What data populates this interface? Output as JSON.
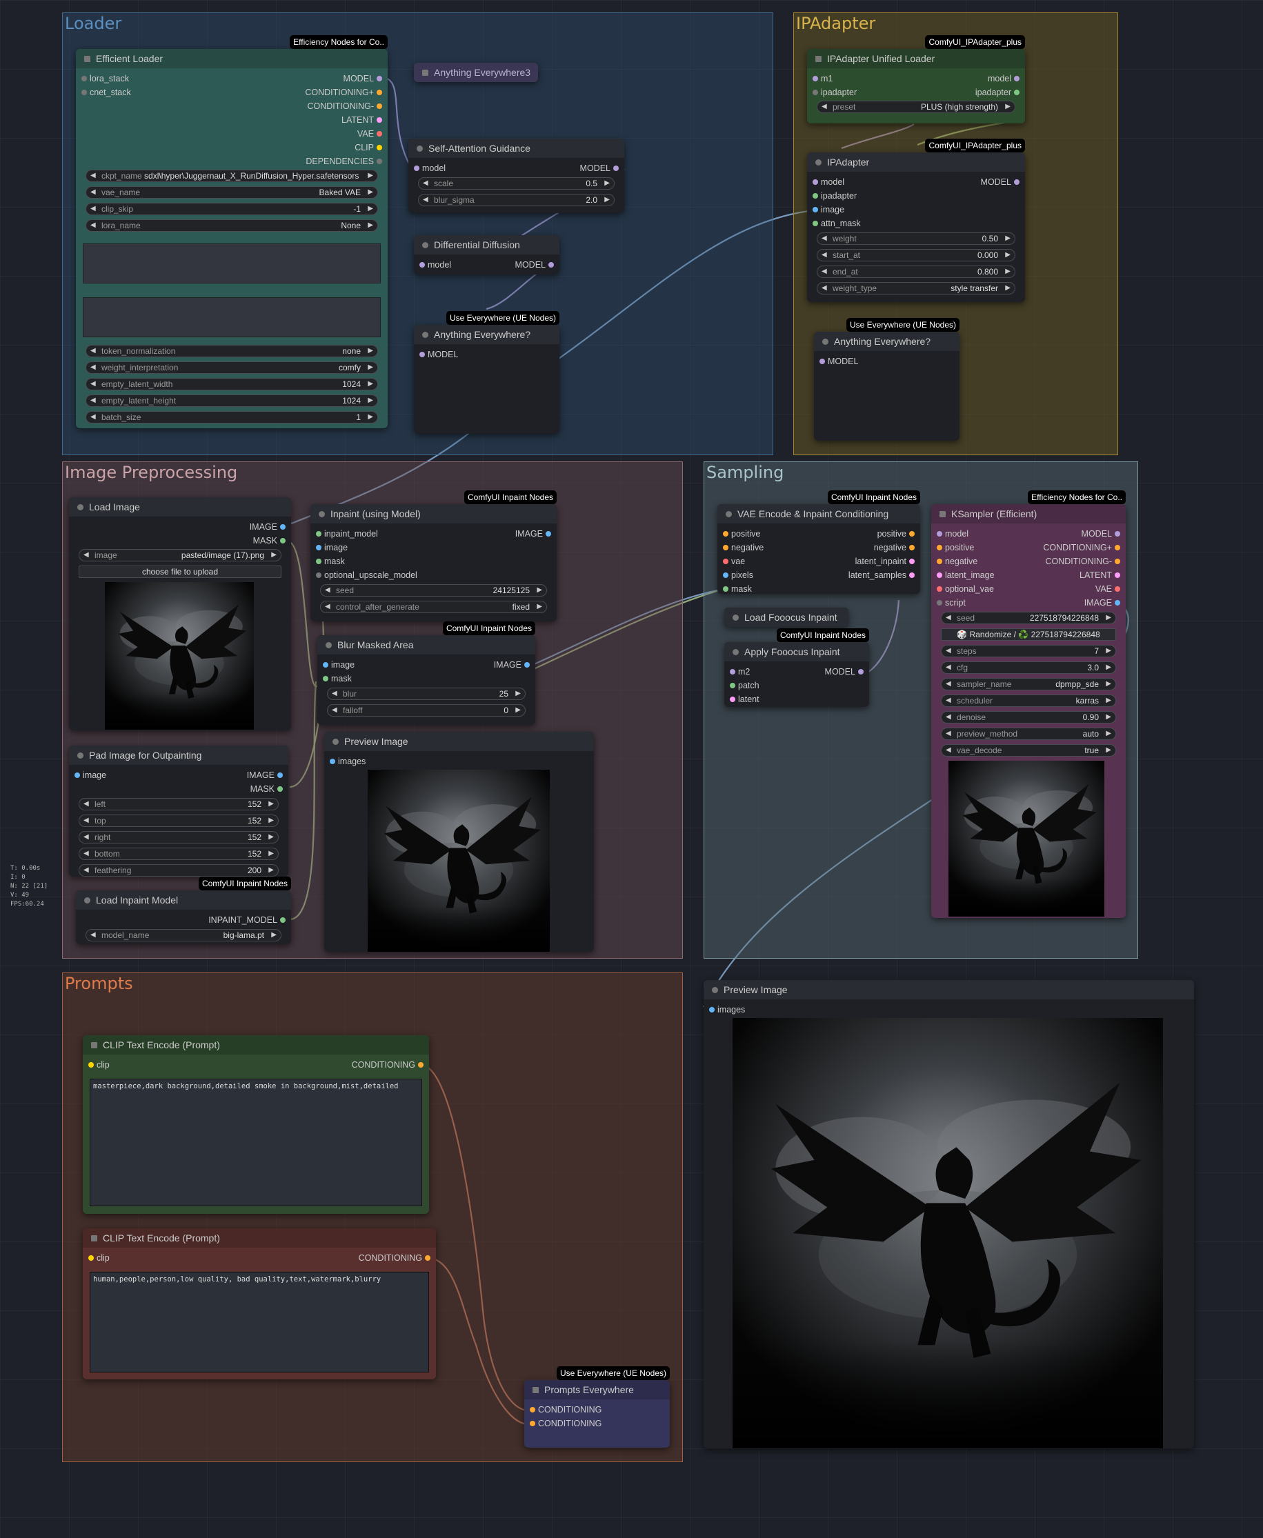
{
  "groups": {
    "loader": "Loader",
    "ipadapter": "IPAdapter",
    "preprocess": "Image Preprocessing",
    "sampling": "Sampling",
    "prompts": "Prompts"
  },
  "colors": {
    "model": "#b39ddb",
    "conditioning": "#ffa931",
    "latent": "#ff9cf9",
    "vae": "#ff6e6e",
    "clip": "#ffd500",
    "image": "#64b5f6",
    "mask": "#81c784",
    "link_model": "#b49ddb",
    "link_image": "#8aaed6",
    "link_mask": "#a8c58a",
    "link_conditioning": "#e9967a"
  },
  "stats": [
    "T: 0.00s",
    "I: 0",
    "N: 22 [21]",
    "V: 49",
    "FPS:60.24"
  ],
  "efficient_loader": {
    "badge": "Efficiency Nodes for Co..",
    "title": "Efficient Loader",
    "in": [
      "lora_stack",
      "cnet_stack"
    ],
    "out": [
      "MODEL",
      "CONDITIONING+",
      "CONDITIONING-",
      "LATENT",
      "VAE",
      "CLIP",
      "DEPENDENCIES"
    ],
    "ckpt_label": "ckpt_name",
    "ckpt_value": "sdxl\\hyper\\Juggernaut_X_RunDiffusion_Hyper.safetensors",
    "widgets": [
      {
        "k": "vae_name",
        "v": "Baked VAE"
      },
      {
        "k": "clip_skip",
        "v": "-1"
      },
      {
        "k": "lora_name",
        "v": "None"
      }
    ],
    "widgets2": [
      {
        "k": "token_normalization",
        "v": "none"
      },
      {
        "k": "weight_interpretation",
        "v": "comfy"
      },
      {
        "k": "empty_latent_width",
        "v": "1024"
      },
      {
        "k": "empty_latent_height",
        "v": "1024"
      },
      {
        "k": "batch_size",
        "v": "1"
      }
    ]
  },
  "anything3": {
    "title": "Anything Everywhere3"
  },
  "sag": {
    "title": "Self-Attention Guidance",
    "in": "model",
    "out": "MODEL",
    "widgets": [
      {
        "k": "scale",
        "v": "0.5"
      },
      {
        "k": "blur_sigma",
        "v": "2.0"
      }
    ]
  },
  "diffdiff": {
    "title": "Differential Diffusion",
    "in": "model",
    "out": "MODEL"
  },
  "anything_l": {
    "badge": "Use Everywhere (UE Nodes)",
    "title": "Anything Everywhere?",
    "in": "MODEL"
  },
  "ip_loader": {
    "badge": "ComfyUI_IPAdapter_plus",
    "title": "IPAdapter Unified Loader",
    "in": [
      "m1",
      "ipadapter"
    ],
    "out": [
      "model",
      "ipadapter"
    ],
    "preset_k": "preset",
    "preset_v": "PLUS (high strength)"
  },
  "ipadapter": {
    "badge": "ComfyUI_IPAdapter_plus",
    "title": "IPAdapter",
    "in": [
      "model",
      "ipadapter",
      "image",
      "attn_mask"
    ],
    "out": "MODEL",
    "widgets": [
      {
        "k": "weight",
        "v": "0.50"
      },
      {
        "k": "start_at",
        "v": "0.000"
      },
      {
        "k": "end_at",
        "v": "0.800"
      },
      {
        "k": "weight_type",
        "v": "style transfer"
      }
    ]
  },
  "anything_r": {
    "badge": "Use Everywhere (UE Nodes)",
    "title": "Anything Everywhere?",
    "in": "MODEL"
  },
  "load_image": {
    "title": "Load Image",
    "out": [
      "IMAGE",
      "MASK"
    ],
    "image_k": "image",
    "image_v": "pasted/image (17).png",
    "upload": "choose file to upload"
  },
  "inpaint_model": {
    "badge": "ComfyUI Inpaint Nodes",
    "title": "Inpaint (using Model)",
    "in": [
      "inpaint_model",
      "image",
      "mask",
      "optional_upscale_model"
    ],
    "out": "IMAGE",
    "widgets": [
      {
        "k": "seed",
        "v": "24125125"
      },
      {
        "k": "control_after_generate",
        "v": "fixed"
      }
    ]
  },
  "blur": {
    "badge": "ComfyUI Inpaint Nodes",
    "title": "Blur Masked Area",
    "in": [
      "image",
      "mask"
    ],
    "out": "IMAGE",
    "widgets": [
      {
        "k": "blur",
        "v": "25"
      },
      {
        "k": "falloff",
        "v": "0"
      }
    ]
  },
  "pad": {
    "title": "Pad Image for Outpainting",
    "in": "image",
    "out": [
      "IMAGE",
      "MASK"
    ],
    "widgets": [
      {
        "k": "left",
        "v": "152"
      },
      {
        "k": "top",
        "v": "152"
      },
      {
        "k": "right",
        "v": "152"
      },
      {
        "k": "bottom",
        "v": "152"
      },
      {
        "k": "feathering",
        "v": "200"
      }
    ]
  },
  "preview_small": {
    "title": "Preview Image",
    "in": "images"
  },
  "load_inpaint": {
    "badge": "ComfyUI Inpaint Nodes",
    "title": "Load Inpaint Model",
    "out": "INPAINT_MODEL",
    "widget_k": "model_name",
    "widget_v": "big-lama.pt"
  },
  "vae_encode": {
    "badge": "ComfyUI Inpaint Nodes",
    "title": "VAE Encode & Inpaint Conditioning",
    "in": [
      "positive",
      "negative",
      "vae",
      "pixels",
      "mask"
    ],
    "out": [
      "positive",
      "negative",
      "latent_inpaint",
      "latent_samples"
    ]
  },
  "fooocus_load": {
    "title": "Load Fooocus Inpaint"
  },
  "fooocus_apply": {
    "badge": "ComfyUI Inpaint Nodes",
    "title": "Apply Fooocus Inpaint",
    "in": [
      "m2",
      "patch",
      "latent"
    ],
    "out": "MODEL"
  },
  "ksampler": {
    "badge": "Efficiency Nodes for Co..",
    "title": "KSampler (Efficient)",
    "in": [
      "model",
      "positive",
      "negative",
      "latent_image",
      "optional_vae",
      "script"
    ],
    "out": [
      "MODEL",
      "CONDITIONING+",
      "CONDITIONING-",
      "LATENT",
      "VAE",
      "IMAGE"
    ],
    "seed_k": "seed",
    "seed_v": "227518794226848",
    "randomize": "🎲 Randomize / ♻️ 227518794226848",
    "widgets": [
      {
        "k": "steps",
        "v": "7"
      },
      {
        "k": "cfg",
        "v": "3.0"
      },
      {
        "k": "sampler_name",
        "v": "dpmpp_sde"
      },
      {
        "k": "scheduler",
        "v": "karras"
      },
      {
        "k": "denoise",
        "v": "0.90"
      },
      {
        "k": "preview_method",
        "v": "auto"
      },
      {
        "k": "vae_decode",
        "v": "true"
      }
    ]
  },
  "preview_large": {
    "title": "Preview Image",
    "in": "images"
  },
  "clip_pos": {
    "title": "CLIP Text Encode (Prompt)",
    "in": "clip",
    "out": "CONDITIONING",
    "text": "masterpiece,dark background,detailed smoke in background,mist,detailed"
  },
  "clip_neg": {
    "title": "CLIP Text Encode (Prompt)",
    "in": "clip",
    "out": "CONDITIONING",
    "text": "human,people,person,low quality, bad quality,text,watermark,blurry"
  },
  "prompts_everywhere": {
    "badge": "Use Everywhere (UE Nodes)",
    "title": "Prompts Everywhere",
    "in": [
      "CONDITIONING",
      "CONDITIONING"
    ]
  }
}
